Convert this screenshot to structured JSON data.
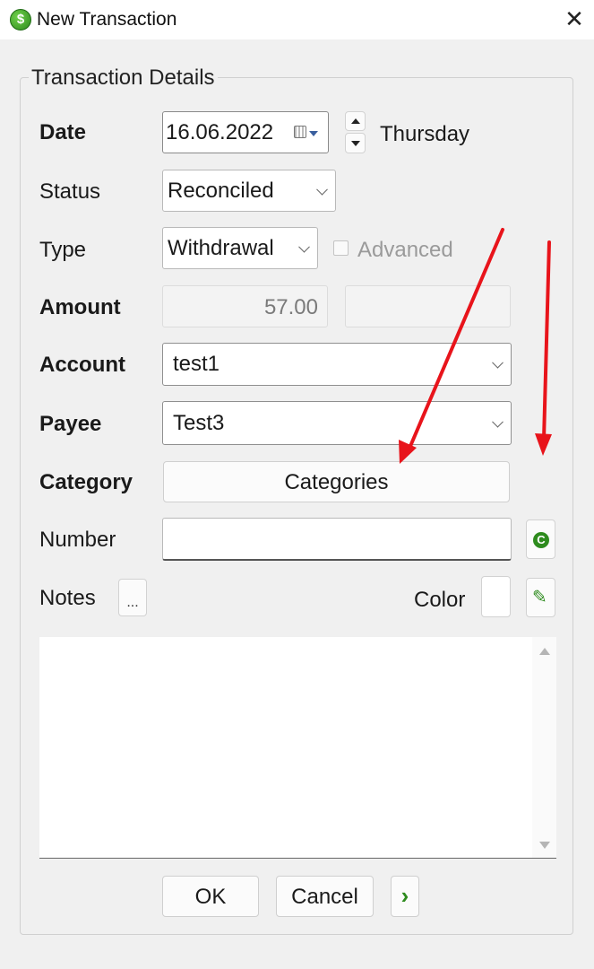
{
  "window": {
    "title": "New Transaction",
    "close_glyph": "✕",
    "app_icon_glyph": "$"
  },
  "group": {
    "legend": "Transaction Details"
  },
  "date": {
    "label": "Date",
    "value": "16.06.2022",
    "weekday": "Thursday"
  },
  "status": {
    "label": "Status",
    "value": "Reconciled"
  },
  "type": {
    "label": "Type",
    "value": "Withdrawal",
    "advanced_label": "Advanced",
    "advanced_checked": false
  },
  "amount": {
    "label": "Amount",
    "value": "57.00",
    "second_value": ""
  },
  "account": {
    "label": "Account",
    "value": "test1"
  },
  "payee": {
    "label": "Payee",
    "value": "Test3"
  },
  "category": {
    "label": "Category",
    "button_label": "Categories"
  },
  "number": {
    "label": "Number",
    "value": ""
  },
  "notes": {
    "label": "Notes",
    "ellipsis_label": "...",
    "value": ""
  },
  "color": {
    "label": "Color"
  },
  "buttons": {
    "ok": "OK",
    "cancel": "Cancel",
    "more": "›"
  },
  "colors": {
    "accent_green": "#2e8b1e",
    "annotation_red": "#e8141b"
  }
}
